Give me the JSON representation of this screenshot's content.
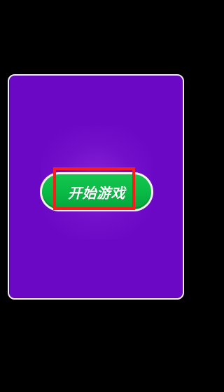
{
  "dialog": {
    "start_button_label": "开始游戏"
  },
  "colors": {
    "background": "#000000",
    "card": "#6b08c6",
    "card_border": "#f2eefc",
    "button_green": "#08b945",
    "button_rim": "#f6f3ee",
    "highlight": "#ff1a1a"
  }
}
